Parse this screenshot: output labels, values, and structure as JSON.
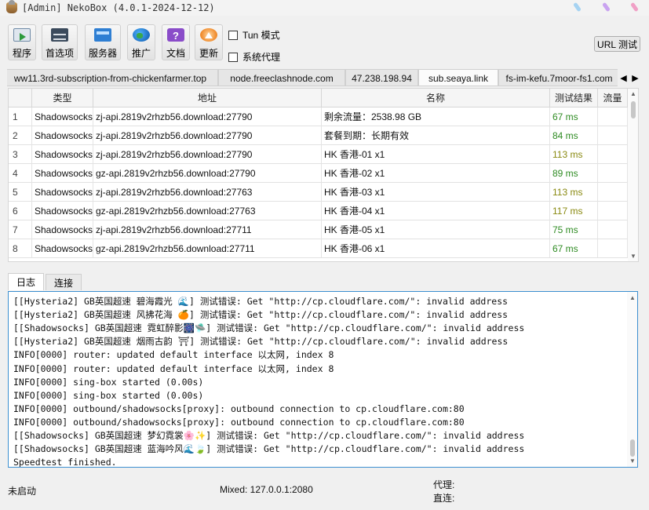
{
  "window": {
    "title": "[Admin] NekoBox (4.0.1-2024-12-12)"
  },
  "toolbar": {
    "buttons": [
      {
        "label": "程序",
        "icon": "program-icon"
      },
      {
        "label": "首选项",
        "icon": "preferences-icon"
      },
      {
        "label": "服务器",
        "icon": "server-icon"
      },
      {
        "label": "推广",
        "icon": "globe-icon"
      },
      {
        "label": "文档",
        "icon": "docs-icon"
      },
      {
        "label": "更新",
        "icon": "update-icon"
      }
    ],
    "tun_mode": {
      "label": "Tun 模式",
      "checked": false
    },
    "system_proxy": {
      "label": "系统代理",
      "checked": false
    },
    "url_test_label": "URL 测试"
  },
  "groups": {
    "tabs": [
      {
        "label": "ww11.3rd-subscription-from-chickenfarmer.top",
        "active": false
      },
      {
        "label": "node.freeclashnode.com",
        "active": false
      },
      {
        "label": "47.238.198.94",
        "active": false
      },
      {
        "label": "sub.seaya.link",
        "active": true
      },
      {
        "label": "fs-im-kefu.7moor-fs1.com",
        "active": false
      }
    ]
  },
  "table": {
    "headers": [
      "类型",
      "地址",
      "名称",
      "测试结果",
      "流量"
    ],
    "rows": [
      {
        "num": "1",
        "type": "Shadowsocks",
        "address": "zj-api.2819v2rhzb56.download:27790",
        "name": "剩余流量：2538.98 GB",
        "result": "67 ms",
        "traffic": ""
      },
      {
        "num": "2",
        "type": "Shadowsocks",
        "address": "zj-api.2819v2rhzb56.download:27790",
        "name": "套餐到期：长期有效",
        "result": "84 ms",
        "traffic": ""
      },
      {
        "num": "3",
        "type": "Shadowsocks",
        "address": "zj-api.2819v2rhzb56.download:27790",
        "name": "HK 香港-01 x1",
        "result": "113 ms",
        "traffic": ""
      },
      {
        "num": "4",
        "type": "Shadowsocks",
        "address": "gz-api.2819v2rhzb56.download:27790",
        "name": "HK 香港-02 x1",
        "result": "89 ms",
        "traffic": ""
      },
      {
        "num": "5",
        "type": "Shadowsocks",
        "address": "zj-api.2819v2rhzb56.download:27763",
        "name": "HK 香港-03 x1",
        "result": "113 ms",
        "traffic": ""
      },
      {
        "num": "6",
        "type": "Shadowsocks",
        "address": "gz-api.2819v2rhzb56.download:27763",
        "name": "HK 香港-04 x1",
        "result": "117 ms",
        "traffic": ""
      },
      {
        "num": "7",
        "type": "Shadowsocks",
        "address": "zj-api.2819v2rhzb56.download:27711",
        "name": "HK 香港-05 x1",
        "result": "75 ms",
        "traffic": ""
      },
      {
        "num": "8",
        "type": "Shadowsocks",
        "address": "gz-api.2819v2rhzb56.download:27711",
        "name": "HK 香港-06 x1",
        "result": "67 ms",
        "traffic": ""
      }
    ]
  },
  "log": {
    "tabs": [
      "日志",
      "连接"
    ],
    "lines": [
      "[[Hysteria2] GB英国超速 碧海霞光 🌊] 测试错误: Get \"http://cp.cloudflare.com/\": invalid address",
      "[[Hysteria2] GB英国超速 风拂花海 🍊] 测试错误: Get \"http://cp.cloudflare.com/\": invalid address",
      "[[Shadowsocks] GB英国超速 霓虹醉影🎆🛸] 测试错误: Get \"http://cp.cloudflare.com/\": invalid address",
      "[[Hysteria2] GB英国超速 烟雨古韵 ⛩] 测试错误: Get \"http://cp.cloudflare.com/\": invalid address",
      "INFO[0000] router: updated default interface 以太网, index 8",
      "INFO[0000] router: updated default interface 以太网, index 8",
      "INFO[0000] sing-box started (0.00s)",
      "INFO[0000] sing-box started (0.00s)",
      "INFO[0000] outbound/shadowsocks[proxy]: outbound connection to cp.cloudflare.com:80",
      "INFO[0000] outbound/shadowsocks[proxy]: outbound connection to cp.cloudflare.com:80",
      "[[Shadowsocks] GB英国超速 梦幻霓裳🌸✨] 测试错误: Get \"http://cp.cloudflare.com/\": invalid address",
      "[[Shadowsocks] GB英国超速 蓝海吟风🌊🍃] 测试错误: Get \"http://cp.cloudflare.com/\": invalid address",
      "Speedtest finished."
    ]
  },
  "status": {
    "state": "未启动",
    "mixed": "Mixed: 127.0.0.1:2080",
    "proxy_label": "代理:",
    "direct_label": "直连:"
  }
}
